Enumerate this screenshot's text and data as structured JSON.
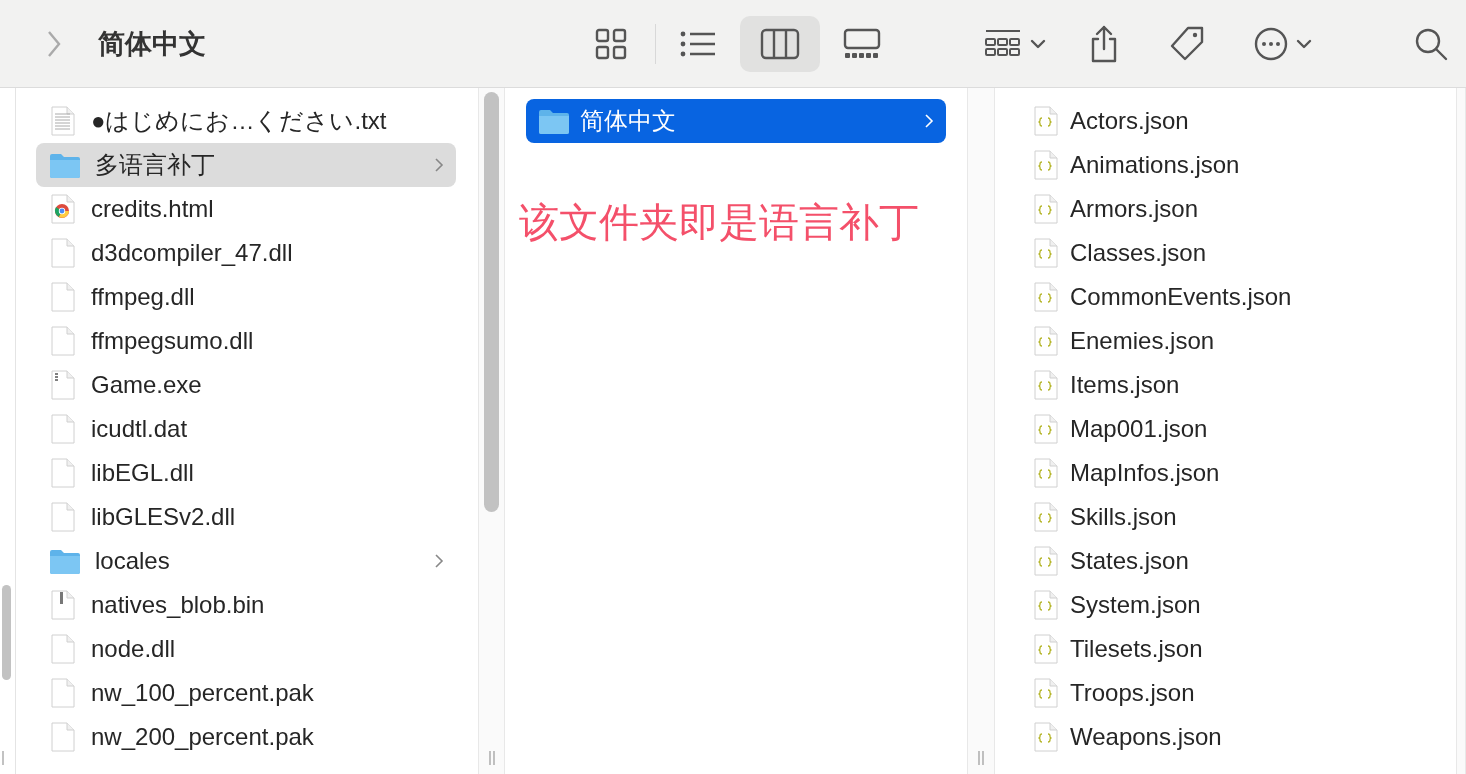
{
  "toolbar": {
    "title": "简体中文",
    "views": [
      {
        "kind": "icons",
        "selected": false
      },
      {
        "kind": "list",
        "selected": false
      },
      {
        "kind": "columns",
        "selected": true
      },
      {
        "kind": "gallery",
        "selected": false
      }
    ]
  },
  "columns": [
    {
      "focused": false,
      "scrollbar": true,
      "items": [
        {
          "kind": "text",
          "name": "●はじめにお…ください.txt",
          "selected": false
        },
        {
          "kind": "folder",
          "name": "多语言补丁",
          "selected": true
        },
        {
          "kind": "html",
          "name": "credits.html",
          "selected": false
        },
        {
          "kind": "file",
          "name": "d3dcompiler_47.dll",
          "selected": false
        },
        {
          "kind": "file",
          "name": "ffmpeg.dll",
          "selected": false
        },
        {
          "kind": "file",
          "name": "ffmpegsumo.dll",
          "selected": false
        },
        {
          "kind": "exe",
          "name": "Game.exe",
          "selected": false
        },
        {
          "kind": "file",
          "name": "icudtl.dat",
          "selected": false
        },
        {
          "kind": "file",
          "name": "libEGL.dll",
          "selected": false
        },
        {
          "kind": "file",
          "name": "libGLESv2.dll",
          "selected": false
        },
        {
          "kind": "folder",
          "name": "locales",
          "selected": false
        },
        {
          "kind": "archive",
          "name": "natives_blob.bin",
          "selected": false
        },
        {
          "kind": "file",
          "name": "node.dll",
          "selected": false
        },
        {
          "kind": "file",
          "name": "nw_100_percent.pak",
          "selected": false
        },
        {
          "kind": "file",
          "name": "nw_200_percent.pak",
          "selected": false
        }
      ]
    },
    {
      "focused": true,
      "scrollbar": false,
      "annotation": "该文件夹即是语言补丁",
      "items": [
        {
          "kind": "folder",
          "name": "简体中文",
          "selected": true
        }
      ]
    },
    {
      "scrollbar": false,
      "items": [
        {
          "kind": "json",
          "name": "Actors.json",
          "selected": false
        },
        {
          "kind": "json",
          "name": "Animations.json",
          "selected": false
        },
        {
          "kind": "json",
          "name": "Armors.json",
          "selected": false
        },
        {
          "kind": "json",
          "name": "Classes.json",
          "selected": false
        },
        {
          "kind": "json",
          "name": "CommonEvents.json",
          "selected": false
        },
        {
          "kind": "json",
          "name": "Enemies.json",
          "selected": false
        },
        {
          "kind": "json",
          "name": "Items.json",
          "selected": false
        },
        {
          "kind": "json",
          "name": "Map001.json",
          "selected": false
        },
        {
          "kind": "json",
          "name": "MapInfos.json",
          "selected": false
        },
        {
          "kind": "json",
          "name": "Skills.json",
          "selected": false
        },
        {
          "kind": "json",
          "name": "States.json",
          "selected": false
        },
        {
          "kind": "json",
          "name": "System.json",
          "selected": false
        },
        {
          "kind": "json",
          "name": "Tilesets.json",
          "selected": false
        },
        {
          "kind": "json",
          "name": "Troops.json",
          "selected": false
        },
        {
          "kind": "json",
          "name": "Weapons.json",
          "selected": false
        }
      ]
    }
  ]
}
